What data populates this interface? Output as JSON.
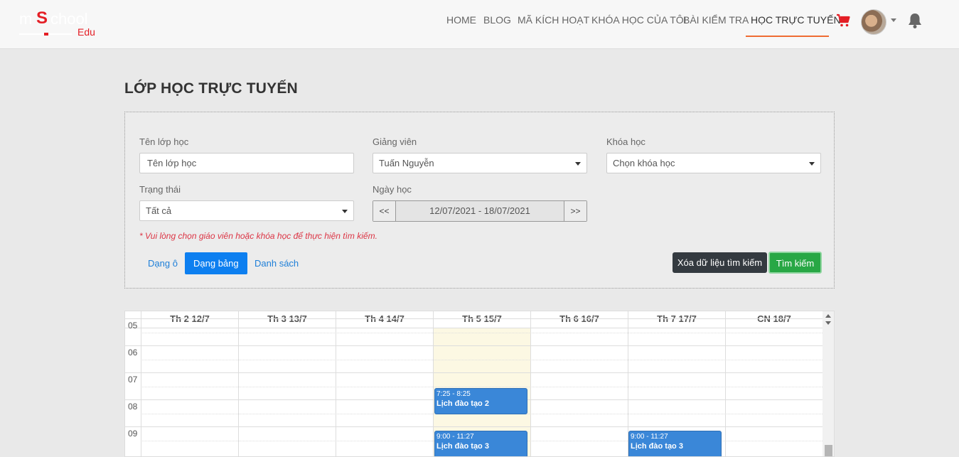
{
  "logo": {
    "word1": "m",
    "letter": "S",
    "word2": "chool",
    "suffix": "Edu"
  },
  "nav": {
    "items": [
      {
        "label": "HOME"
      },
      {
        "label": "BLOG"
      },
      {
        "label": "MÃ KÍCH HOẠT"
      },
      {
        "label": "KHÓA HỌC CỦA TÔI"
      },
      {
        "label": "BÀI KIỂM TRA"
      },
      {
        "label": "HỌC TRỰC TUYẾN"
      }
    ]
  },
  "colors": {
    "accent": "#ef6c33",
    "primary": "#0d7ff0",
    "success": "#28a745",
    "event": "#3a87d8",
    "danger": "#dc3545"
  },
  "page": {
    "title": "LỚP HỌC TRỰC TUYẾN"
  },
  "filters": {
    "class_name": {
      "label": "Tên lớp học",
      "placeholder": "Tên lớp học",
      "value": ""
    },
    "teacher": {
      "label": "Giảng viên",
      "value": "Tuấn Nguyễn"
    },
    "course": {
      "label": "Khóa học",
      "value": "Chọn khóa học"
    },
    "status": {
      "label": "Trạng thái",
      "value": "Tất cả"
    },
    "date": {
      "label": "Ngày học",
      "prev": "<<",
      "range": "12/07/2021 - 18/07/2021",
      "next": ">>"
    },
    "warning": "* Vui lòng chọn giáo viên hoặc khóa học để thực hiện tìm kiếm.",
    "views": [
      {
        "label": "Dạng ô"
      },
      {
        "label": "Dạng bảng"
      },
      {
        "label": "Danh sách"
      }
    ],
    "clear_label": "Xóa dữ liệu tìm kiếm",
    "search_label": "Tìm kiếm"
  },
  "calendar": {
    "days": [
      "Th 2 12/7",
      "Th 3 13/7",
      "Th 4 14/7",
      "Th 5 15/7",
      "Th 6 16/7",
      "Th 7 17/7",
      "CN 18/7"
    ],
    "hours": [
      "05",
      "06",
      "07",
      "08",
      "09"
    ],
    "events": [
      {
        "day": "Th 5 15/7",
        "time": "7:25 - 8:25",
        "title": "Lịch đào tạo 2"
      },
      {
        "day": "Th 5 15/7",
        "time": "9:00 - 11:27",
        "title": "Lịch đào tạo 3"
      },
      {
        "day": "Th 7 17/7",
        "time": "9:00 - 11:27",
        "title": "Lịch đào tạo 3"
      }
    ]
  }
}
